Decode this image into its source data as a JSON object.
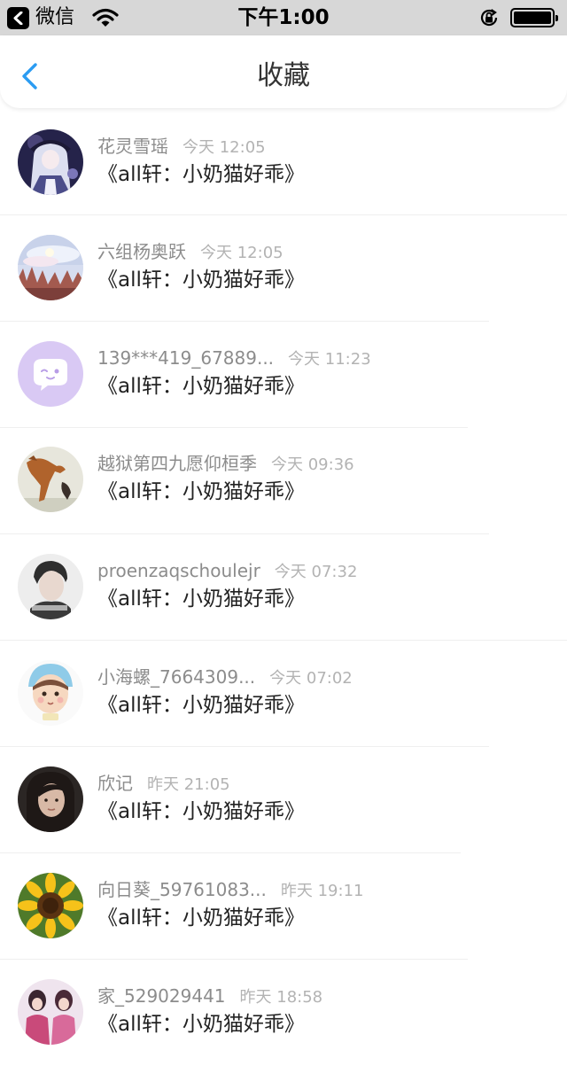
{
  "status_bar": {
    "app": "微信",
    "time": "下午1:00"
  },
  "nav": {
    "title": "收藏"
  },
  "items": [
    {
      "username": "花灵雪瑶",
      "time": "今天 12:05",
      "title": "《all轩：小奶猫好乖》",
      "avatar": "anime-girl-avatar"
    },
    {
      "username": "六组杨奥跃",
      "time": "今天 12:05",
      "title": "《all轩：小奶猫好乖》",
      "avatar": "winter-sky-avatar"
    },
    {
      "username": "139***419_67889...",
      "time": "今天 11:23",
      "title": "《all轩：小奶猫好乖》",
      "avatar": "default-chat-avatar"
    },
    {
      "username": "越狱第四九愿仰桓季",
      "time": "今天 09:36",
      "title": "《all轩：小奶猫好乖》",
      "avatar": "jumping-dog-avatar"
    },
    {
      "username": "proenzaqschoulejr",
      "time": "今天 07:32",
      "title": "《all轩：小奶猫好乖》",
      "avatar": "portrait-boy-avatar"
    },
    {
      "username": "小海螺_7664309...",
      "time": "今天 07:02",
      "title": "《all轩：小奶猫好乖》",
      "avatar": "cartoon-kid-avatar"
    },
    {
      "username": "欣记",
      "time": "昨天 21:05",
      "title": "《all轩：小奶猫好乖》",
      "avatar": "portrait-girl-avatar"
    },
    {
      "username": "向日葵_59761083...",
      "time": "昨天 19:11",
      "title": "《all轩：小奶猫好乖》",
      "avatar": "sunflower-avatar"
    },
    {
      "username": "家_529029441",
      "time": "昨天 18:58",
      "title": "《all轩：小奶猫好乖》",
      "avatar": "group-photo-avatar"
    }
  ],
  "colors": {
    "accent": "#2b9cf2",
    "username": "#8c8c8c",
    "time": "#b3b3b3",
    "title": "#222222",
    "status_bar_bg": "#d7d7d7"
  }
}
